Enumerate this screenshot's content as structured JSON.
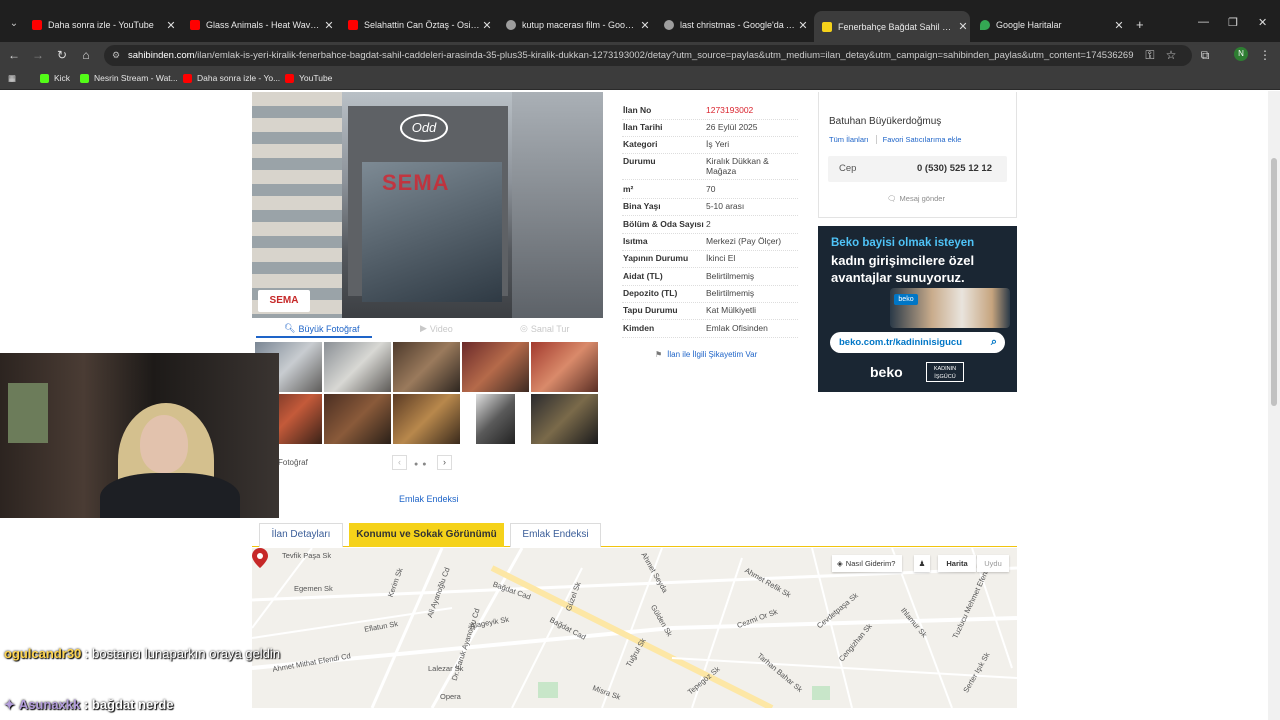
{
  "browser": {
    "tabs": [
      {
        "title": "Daha sonra izle - YouTube",
        "favicon_color": "#ff0000"
      },
      {
        "title": "Glass Animals - Heat Waves - Y",
        "favicon_color": "#ff0000"
      },
      {
        "title": "Selahattin Can Öztaş - Osimhe",
        "favicon_color": "#ff0000"
      },
      {
        "title": "kutup macerası film - Google'd",
        "favicon_color": "#9e9e9e"
      },
      {
        "title": "last christmas - Google'da Ara",
        "favicon_color": "#9e9e9e"
      },
      {
        "title": "Fenerbahçe Bağdat Sahil Cadd",
        "favicon_color": "#f5d21a",
        "active": true
      },
      {
        "title": "Google Haritalar",
        "favicon_color": "#34a853"
      }
    ],
    "url_host": "sahibinden.com",
    "url_path": "/ilan/emlak-is-yeri-kiralik-fenerbahce-bagdat-sahil-caddeleri-arasinda-35-plus35-kiralik-dukkan-1273193002/detay?utm_source=paylas&utm_medium=ilan_detay&utm_campaign=sahibinden_paylas&utm_content=174536269",
    "profile_initial": "N",
    "bookmarks": [
      {
        "label": "Kick",
        "favicon_color": "#53fc18"
      },
      {
        "label": "Nesrin Stream - Wat...",
        "favicon_color": "#53fc18"
      },
      {
        "label": "Daha sonra izle - Yo...",
        "favicon_color": "#ff0000"
      },
      {
        "label": "YouTube",
        "favicon_color": "#ff0000"
      }
    ]
  },
  "listing": {
    "photo_watermark": "SEMA",
    "photo_logo": "SEMA",
    "photo_sign": "Odd",
    "photo_tabs": {
      "photo": "Büyük Fotoğraf",
      "video": "Video",
      "tour": "Sanal Tur"
    },
    "photo_count_label": "Fotoğraf",
    "emlak_link": "Emlak Endeksi",
    "details": [
      {
        "key": "İlan No",
        "value": "1273193002",
        "highlight": true
      },
      {
        "key": "İlan Tarihi",
        "value": "26 Eylül 2025"
      },
      {
        "key": "Kategori",
        "value": "İş Yeri"
      },
      {
        "key": "Durumu",
        "value": "Kiralık Dükkan & Mağaza"
      },
      {
        "key": "m²",
        "value": "70"
      },
      {
        "key": "Bina Yaşı",
        "value": "5-10 arası"
      },
      {
        "key": "Bölüm & Oda Sayısı",
        "value": "2"
      },
      {
        "key": "Isıtma",
        "value": "Merkezi (Pay Ölçer)"
      },
      {
        "key": "Yapının Durumu",
        "value": "İkinci El"
      },
      {
        "key": "Aidat (TL)",
        "value": "Belirtilmemiş"
      },
      {
        "key": "Depozito (TL)",
        "value": "Belirtilmemiş"
      },
      {
        "key": "Tapu Durumu",
        "value": "Kat Mülkiyetli"
      },
      {
        "key": "Kimden",
        "value": "Emlak Ofisinden"
      }
    ],
    "complaint": "İlan ile İlgili Şikayetim Var"
  },
  "seller": {
    "name": "Batuhan Büyükerdoğmuş",
    "all_listings": "Tüm İlanları",
    "add_favorite": "Favori Satıcılarıma ekle",
    "phone_label": "Cep",
    "phone": "0 (530) 525 12 12",
    "message": "Mesaj gönder"
  },
  "ad": {
    "line1": "Beko bayisi olmak isteyen",
    "line2": "kadın girişimcilere özel",
    "line3": "avantajlar sunuyoruz.",
    "chip": "beko",
    "url": "beko.com.tr/kadininisigucu",
    "brand": "beko",
    "brand2": "KADININ İŞGÜCÜ"
  },
  "section_tabs": [
    {
      "label": "İlan Detayları"
    },
    {
      "label": "Konumu ve Sokak Görünümü",
      "active": true
    },
    {
      "label": "Emlak Endeksi"
    }
  ],
  "map": {
    "directions": "Nasıl Giderim?",
    "map_mode": "Harita",
    "sat_mode": "Uydu",
    "streets": [
      "Tevfik Paşa Sk",
      "Egemen Sk",
      "Kerim Sk",
      "Ali Ayanoğlu Cd",
      "Eflatun Sk",
      "Dr. Faruk Ayanoğlu Cd",
      "Alageyik Sk",
      "Bağdat Cad",
      "Bağdat Cad",
      "Ahmet Mithat Efendi Cd",
      "Lalezar Sk",
      "Opera",
      "Güzel Sk",
      "Gülden Sk",
      "Tuğrul Sk",
      "Ahmet Refik Sk",
      "Cezmi Or Sk",
      "Ahmet Seyda",
      "Cevdetpaşa Sk",
      "Cengizhan Sk",
      "Ihlamur Sk",
      "Tuzlucu Mehmet Efendi",
      "Serter Işık Sk",
      "Tepegöz Sk",
      "Tarhan Bahar Sk",
      "Misra Sk"
    ]
  },
  "stream": {
    "chat": [
      {
        "user": "ogulcandr30",
        "message": "bostancı lunaparkın oraya geldin"
      },
      {
        "user": "Asunaxkk",
        "message": "bağdat nerde"
      }
    ]
  }
}
